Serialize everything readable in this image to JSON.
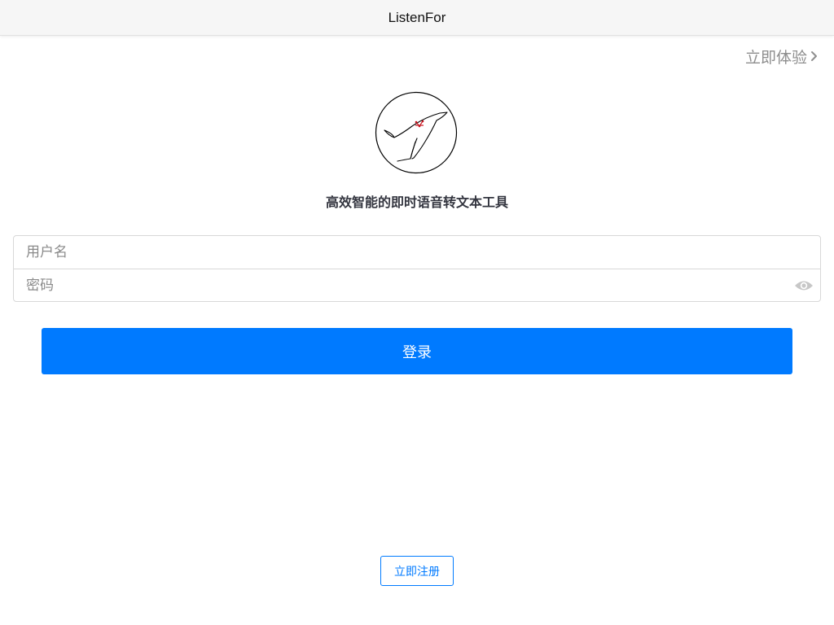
{
  "navbar": {
    "title": "ListenFor"
  },
  "try_link": {
    "label": "立即体验",
    "icon": "chevron-right-icon",
    "color": "#8e8e8e"
  },
  "logo": {
    "icon": "dolphin-logo-icon"
  },
  "slogan": "高效智能的即时语音转文本工具",
  "form": {
    "username": {
      "placeholder": "用户名",
      "value": ""
    },
    "password": {
      "placeholder": "密码",
      "value": "",
      "icon": "eye-icon"
    }
  },
  "login_button": {
    "label": "登录",
    "color": "#007aff"
  },
  "register_button": {
    "label": "立即注册"
  }
}
